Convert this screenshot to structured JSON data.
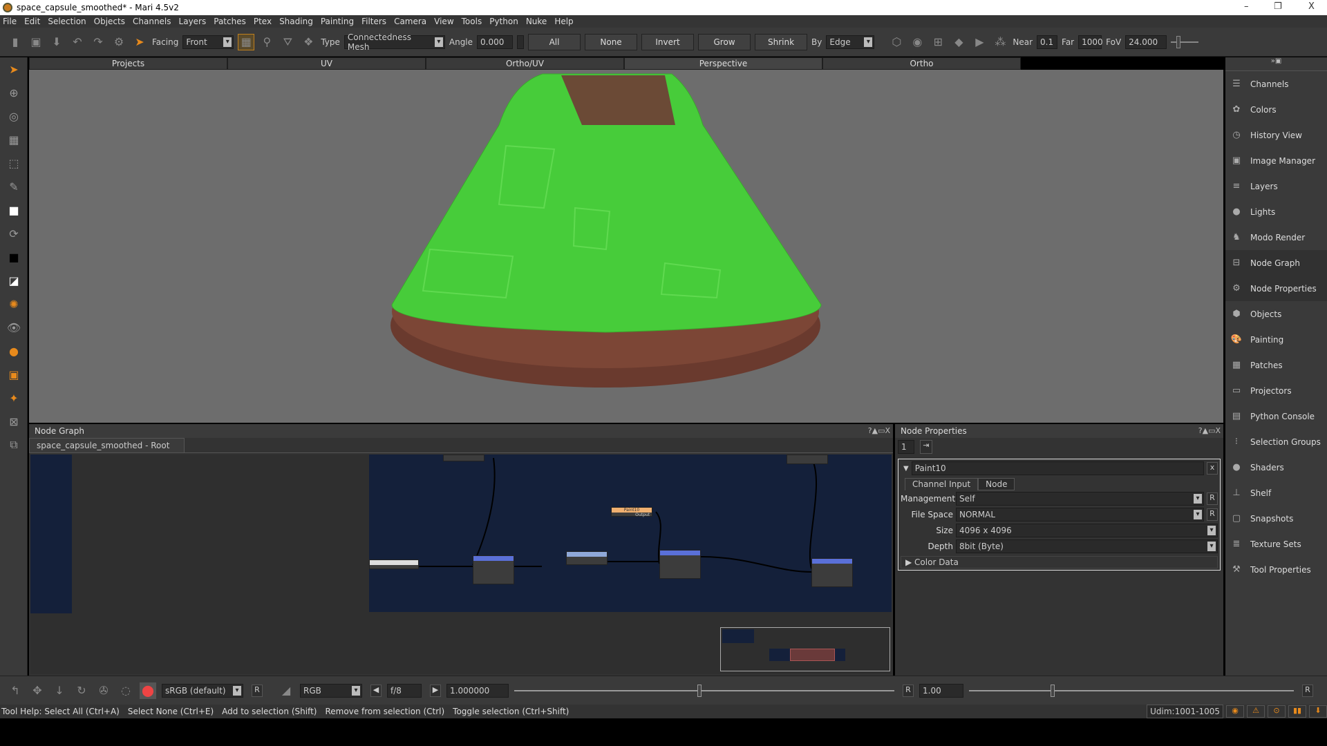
{
  "window": {
    "title": "space_capsule_smoothed* - Mari 4.5v2",
    "minimize": "–",
    "maximize": "❐",
    "close": "X"
  },
  "menu": [
    "File",
    "Edit",
    "Selection",
    "Objects",
    "Channels",
    "Layers",
    "Patches",
    "Ptex",
    "Shading",
    "Painting",
    "Filters",
    "Camera",
    "View",
    "Tools",
    "Python",
    "Nuke",
    "Help"
  ],
  "toolbar": {
    "facing_label": "Facing",
    "facing_value": "Front",
    "type_label": "Type",
    "type_value": "Connectedness Mesh",
    "angle_label": "Angle",
    "angle_value": "0.000",
    "all": "All",
    "none": "None",
    "invert": "Invert",
    "grow": "Grow",
    "shrink": "Shrink",
    "by_label": "By",
    "by_value": "Edge",
    "near_label": "Near",
    "near_value": "0.1",
    "far_label": "Far",
    "far_value": "1000",
    "fov_label": "FoV",
    "fov_value": "24.000"
  },
  "view_tabs": [
    "Projects",
    "UV",
    "Ortho/UV",
    "Perspective",
    "Ortho"
  ],
  "active_view_tab": "Perspective",
  "right_panel": {
    "header_icons": "»▣",
    "items": [
      "Channels",
      "Colors",
      "History View",
      "Image Manager",
      "Layers",
      "Lights",
      "Modo Render",
      "Node Graph",
      "Node Properties",
      "Objects",
      "Painting",
      "Patches",
      "Projectors",
      "Python Console",
      "Selection Groups",
      "Shaders",
      "Shelf",
      "Snapshots",
      "Texture Sets",
      "Tool Properties"
    ]
  },
  "node_graph": {
    "title": "Node Graph",
    "breadcrumb": "space_capsule_smoothed - Root",
    "controls": "?▲▭X",
    "highlight_node": "Paint10",
    "port_output": "Output"
  },
  "node_properties": {
    "title": "Node Properties",
    "controls": "?▲▭X",
    "count": "1",
    "node_name": "Paint10",
    "close": "x",
    "tabs": [
      "Channel Input",
      "Node"
    ],
    "fields": [
      {
        "label": "Management",
        "value": "Self",
        "reset": "R"
      },
      {
        "label": "File Space",
        "value": "NORMAL",
        "reset": "R"
      },
      {
        "label": "Size",
        "value": "4096 x 4096"
      },
      {
        "label": "Depth",
        "value": "8bit  (Byte)"
      }
    ],
    "section": "Color Data"
  },
  "bottom": {
    "colorspace": "sRGB (default)",
    "reset": "R",
    "channel": "RGB",
    "fstop": "f/8",
    "gain": "1.000000",
    "gamma_reset": "R",
    "gamma": "1.00",
    "end_reset": "R"
  },
  "status": {
    "help": [
      "Tool Help: Select All (Ctrl+A)",
      "Select None (Ctrl+E)",
      "Add to selection (Shift)",
      "Remove from selection (Ctrl)",
      "Toggle selection (Ctrl+Shift)"
    ],
    "udim": "Udim:1001-1005"
  },
  "colors": {
    "accent": "#e88a1c",
    "selection_green": "#4cd43a",
    "node_bg": "#14203a"
  }
}
